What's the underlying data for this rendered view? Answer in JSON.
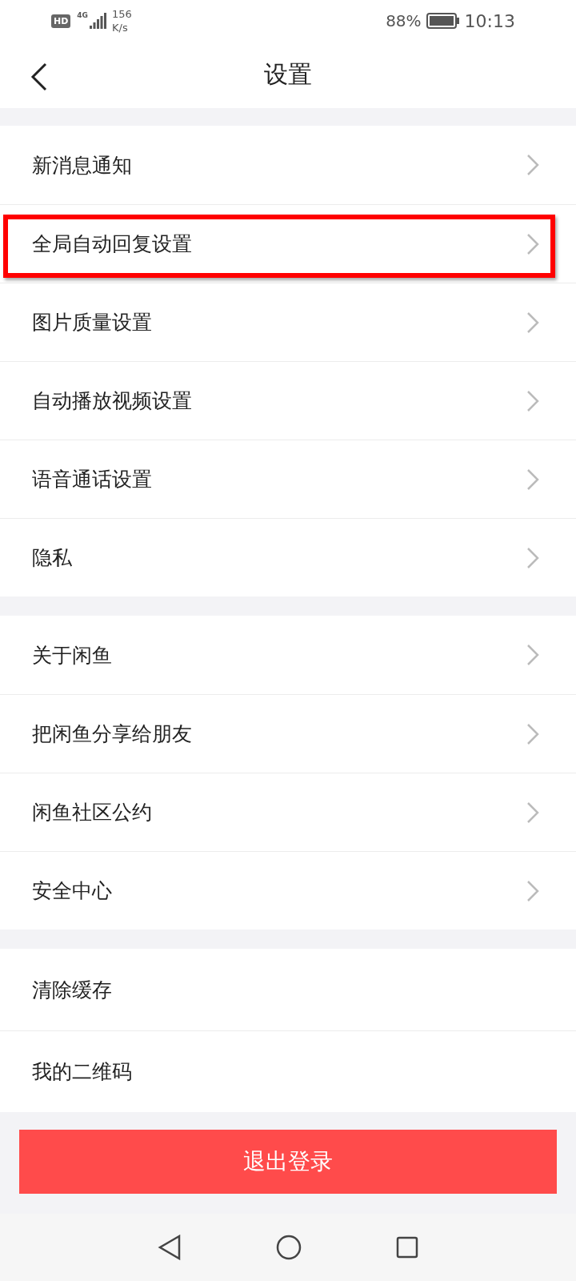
{
  "status_bar": {
    "hd": "HD",
    "network": "4G",
    "speed_value": "156",
    "speed_unit": "K/s",
    "battery": "88%",
    "time": "10:13"
  },
  "header": {
    "title": "设置"
  },
  "groups": [
    {
      "items": [
        {
          "label": "新消息通知",
          "chevron": true,
          "highlighted": false
        },
        {
          "label": "全局自动回复设置",
          "chevron": true,
          "highlighted": true
        },
        {
          "label": "图片质量设置",
          "chevron": true,
          "highlighted": false
        },
        {
          "label": "自动播放视频设置",
          "chevron": true,
          "highlighted": false
        },
        {
          "label": "语音通话设置",
          "chevron": true,
          "highlighted": false
        },
        {
          "label": "隐私",
          "chevron": true,
          "highlighted": false
        }
      ]
    },
    {
      "items": [
        {
          "label": "关于闲鱼",
          "chevron": true,
          "highlighted": false
        },
        {
          "label": "把闲鱼分享给朋友",
          "chevron": true,
          "highlighted": false
        },
        {
          "label": "闲鱼社区公约",
          "chevron": true,
          "highlighted": false
        },
        {
          "label": "安全中心",
          "chevron": true,
          "highlighted": false
        }
      ]
    },
    {
      "items": [
        {
          "label": "清除缓存",
          "chevron": false,
          "highlighted": false
        },
        {
          "label": "我的二维码",
          "chevron": false,
          "highlighted": false
        }
      ]
    }
  ],
  "logout_button": "退出登录"
}
